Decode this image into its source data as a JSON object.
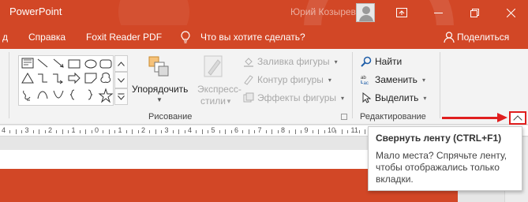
{
  "titlebar": {
    "title": "PowerPoint",
    "user": "Юрий Козырев",
    "ribbon_options_icon": "ribbon-display-options-icon",
    "minimize_icon": "minimize-icon",
    "restore_icon": "restore-icon",
    "close_icon": "close-icon"
  },
  "tabs": {
    "partial": "д",
    "help": "Справка",
    "foxit": "Foxit Reader PDF",
    "tellme": "Что вы хотите сделать?",
    "share": "Поделиться"
  },
  "ribbon": {
    "drawing": {
      "arrange": "Упорядочить",
      "styles_line1": "Экспресс-",
      "styles_line2": "стили",
      "fill": "Заливка фигуры",
      "outline": "Контур фигуры",
      "effects": "Эффекты фигуры",
      "label": "Рисование"
    },
    "editing": {
      "find": "Найти",
      "replace": "Заменить",
      "select": "Выделить",
      "label": "Редактирование"
    }
  },
  "ruler": {
    "numbers": [
      "4",
      "3",
      "2",
      "1",
      "0",
      "1",
      "2",
      "3",
      "4",
      "5",
      "6",
      "7",
      "8",
      "9",
      "10",
      "11",
      "12",
      "13",
      "14",
      "15",
      "16"
    ]
  },
  "tooltip": {
    "title": "Свернуть ленту (CTRL+F1)",
    "body": "Мало места? Спрячьте ленту, чтобы отображались только вкладки."
  },
  "colors": {
    "accent": "#d24726",
    "highlight": "#e01e1e"
  }
}
